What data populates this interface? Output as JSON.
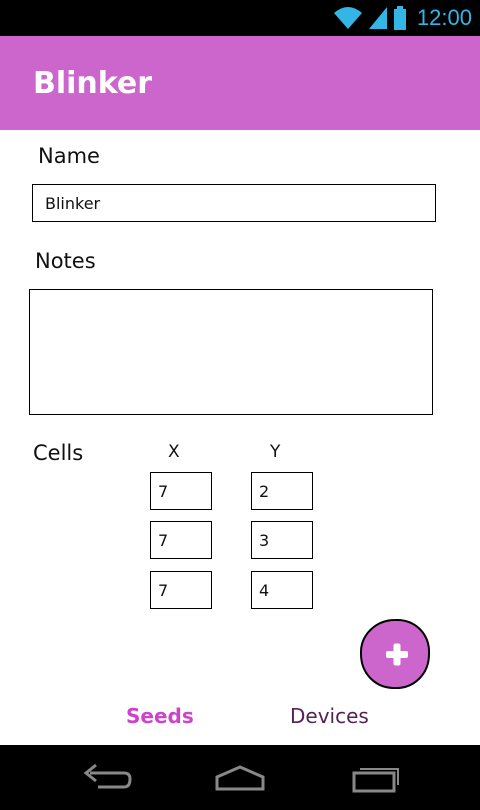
{
  "status_bar": {
    "time": "12:00",
    "icons": [
      "wifi-icon",
      "signal-icon",
      "battery-icon"
    ]
  },
  "action_bar": {
    "title": "Blinker",
    "color": "#cc66cc"
  },
  "form": {
    "name_label": "Name",
    "name_value": "Blinker",
    "notes_label": "Notes",
    "notes_value": "",
    "cells_label": "Cells",
    "x_header": "X",
    "y_header": "Y",
    "cells": [
      {
        "x": "7",
        "y": "2"
      },
      {
        "x": "7",
        "y": "3"
      },
      {
        "x": "7",
        "y": "4"
      }
    ]
  },
  "fab": {
    "icon": "plus-icon",
    "color": "#cc66cc"
  },
  "tabs": {
    "seeds": "Seeds",
    "devices": "Devices",
    "active_color": "#cc44cc"
  },
  "nav_bar": {
    "icons": [
      "back-icon",
      "home-icon",
      "recents-icon"
    ]
  }
}
